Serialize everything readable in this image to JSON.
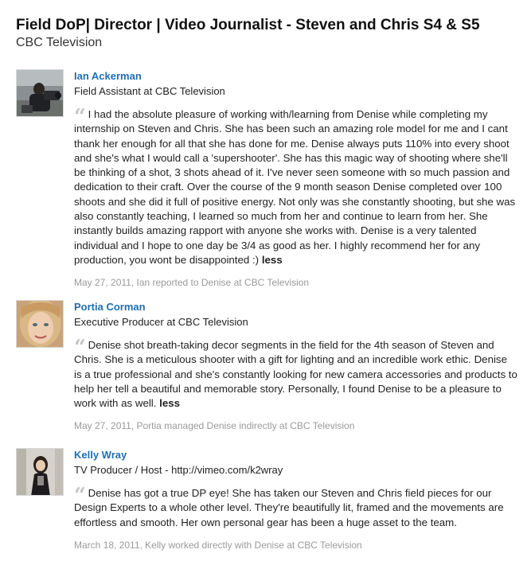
{
  "position": {
    "title": "Field DoP| Director | Video Journalist - Steven and Chris S4 & S5",
    "company": "CBC Television"
  },
  "recommendations": [
    {
      "name": "Ian Ackerman",
      "role": "Field Assistant at CBC Television",
      "text": "I had the absolute pleasure of working with/learning from Denise while completing my internship on Steven and Chris. She has been such an amazing role model for me and I cant thank her enough for all that she has done for me. Denise always puts 110% into every shoot and she's what I would call a 'supershooter'. She has this magic way of shooting where she'll be thinking of a shot, 3 shots ahead of it. I've never seen someone with so much passion and dedication to their craft. Over the course of the 9 month season Denise completed over 100 shoots and she did it full of positive energy. Not only was she constantly shooting, but she was also constantly teaching, I learned so much from her and continue to learn from her. She instantly builds amazing rapport with anyone she works with. Denise is a very talented individual and I hope to one day be 3/4 as good as her. I highly recommend her for any production, you wont be disappointed :)",
      "toggle": "less",
      "meta": "May 27, 2011, Ian reported to Denise at CBC Television"
    },
    {
      "name": "Portia Corman",
      "role": "Executive Producer at CBC Television",
      "text": "Denise shot breath-taking decor segments in the field for the 4th season of Steven and Chris. She is a meticulous shooter with a gift for lighting and an incredible work ethic. Denise is a true professional and she's constantly looking for new camera accessories and products to help her tell a beautiful and memorable story. Personally, I found Denise to be a pleasure to work with as well.",
      "toggle": "less",
      "meta": "May 27, 2011, Portia managed Denise indirectly at CBC Television"
    },
    {
      "name": "Kelly Wray",
      "role": "TV Producer / Host - http://vimeo.com/k2wray",
      "text": "Denise has got a true DP eye! She has taken our Steven and Chris field pieces for our Design Experts to a whole other level. They're beautifully lit, framed and the movements are effortless and smooth. Her own personal gear has been a huge asset to the team.",
      "meta": "March 18, 2011, Kelly worked directly with Denise at CBC Television"
    }
  ],
  "colors": {
    "link": "#1f6fb0",
    "meta": "#9a9a9a",
    "quote": "#c6c6c6"
  }
}
